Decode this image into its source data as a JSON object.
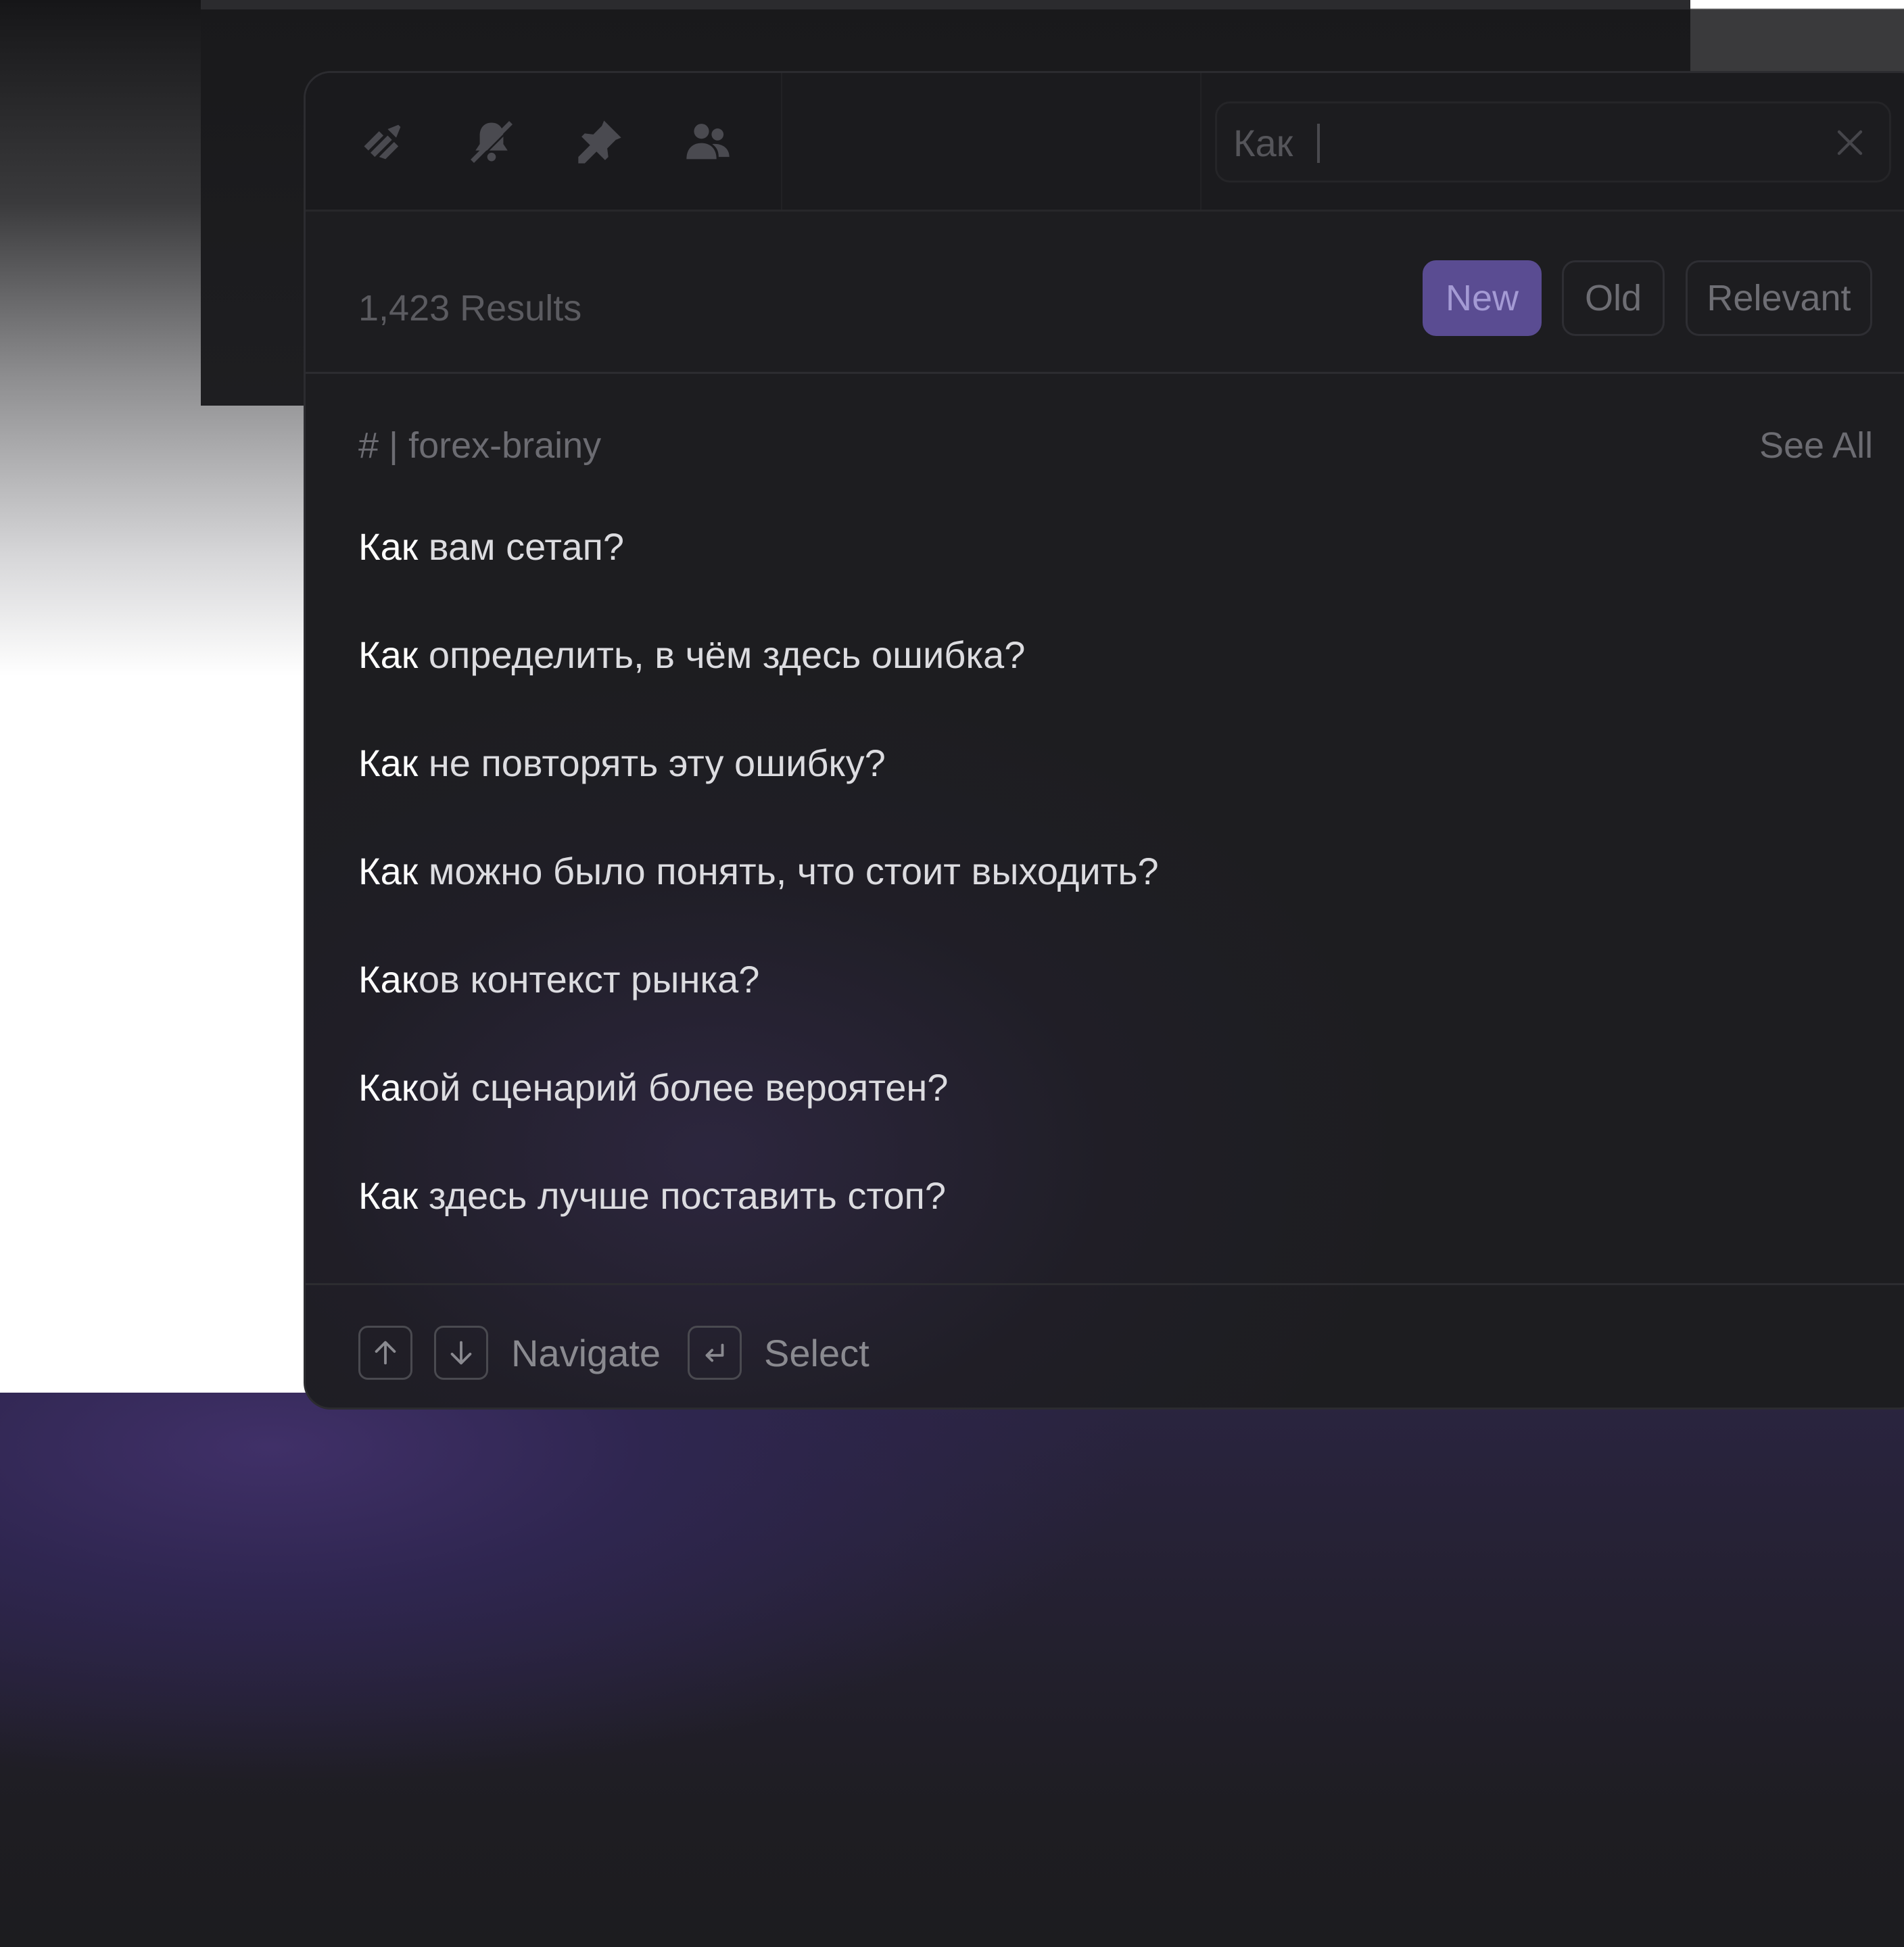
{
  "search": {
    "query": "Как"
  },
  "results": {
    "count_label": "1,423 Results"
  },
  "sort": {
    "options": [
      "New",
      "Old",
      "Relevant"
    ],
    "active": "New"
  },
  "channel": {
    "name": "# | forex-brainy",
    "see_all_label": "See All"
  },
  "items": [
    {
      "match": "Как",
      "rest": " вам сетап?"
    },
    {
      "match": "Как",
      "rest": " определить, в чём здесь ошибка?"
    },
    {
      "match": "Как",
      "rest": " не повторять эту ошибку?"
    },
    {
      "match": "Как",
      "rest": " можно было понять, что стоит выходить?"
    },
    {
      "match": "Как",
      "rest": "ов контекст рынка?"
    },
    {
      "match": "Как",
      "rest": "ой сценарий более вероятен?"
    },
    {
      "match": "Как",
      "rest": " здесь лучше поставить стоп?"
    }
  ],
  "footer": {
    "navigate_label": "Navigate",
    "select_label": "Select"
  },
  "icons": [
    "threads-icon",
    "mute-icon",
    "pin-icon",
    "members-icon",
    "close-icon",
    "arrow-up-icon",
    "arrow-down-icon",
    "enter-icon"
  ],
  "colors": {
    "accent": "#5a4c92",
    "accent_text": "#a49ad4",
    "panel_bg": "#1d1d20"
  }
}
